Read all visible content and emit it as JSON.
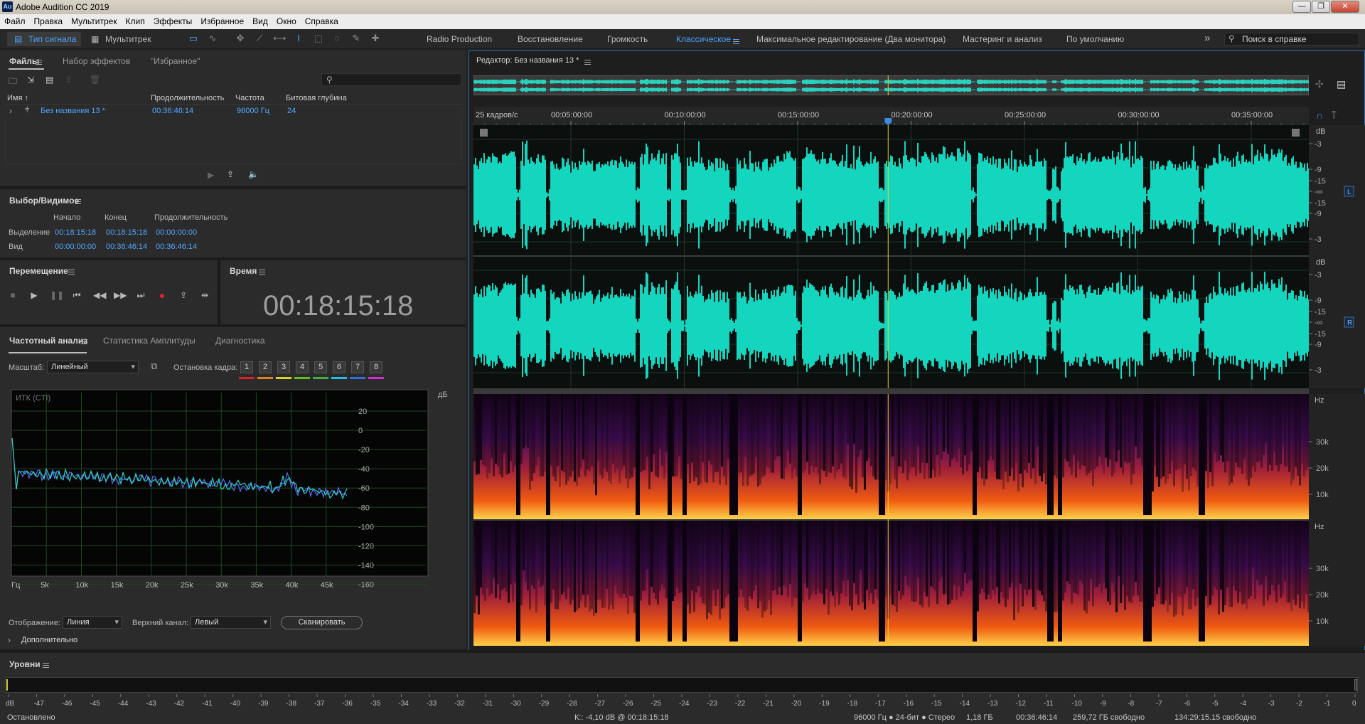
{
  "window": {
    "title": "Adobe Audition CC 2019",
    "app_badge": "Au",
    "controls": [
      "—",
      "❐",
      "✕"
    ]
  },
  "menu": [
    "Файл",
    "Правка",
    "Мультитрек",
    "Клип",
    "Эффекты",
    "Избранное",
    "Вид",
    "Окно",
    "Справка"
  ],
  "toolbar": {
    "waveform_label": "Тип сигнала",
    "multitrack_label": "Мультитрек",
    "workspaces": [
      "Radio Production",
      "Восстановление",
      "Громкость",
      "Классическое",
      "Максимальное редактирование (Два монитора)",
      "Мастеринг и анализ",
      "По умолчанию"
    ],
    "active_workspace": "Классическое",
    "more": "»",
    "help_placeholder": "Поиск в справке"
  },
  "files_panel": {
    "tabs": [
      "Файлы",
      "Набор эффектов",
      "\"Избранное\""
    ],
    "columns": [
      "Имя ↑",
      "Продолжительность",
      "Частота",
      "Битовая глубина"
    ],
    "rows": [
      {
        "name": "Без названия 13 *",
        "duration": "00:36:46:14",
        "rate": "96000 Гц",
        "depth": "24"
      }
    ]
  },
  "selection_panel": {
    "title": "Выбор/Видимое",
    "headers": [
      "Начало",
      "Конец",
      "Продолжительность"
    ],
    "selection_label": "Выделение",
    "selection": [
      "00:18:15:18",
      "00:18:15:18",
      "00:00:00:00"
    ],
    "view_label": "Вид",
    "view": [
      "00:00:00:00",
      "00:36:46:14",
      "00:36:46:14"
    ]
  },
  "transport": {
    "title": "Перемещение"
  },
  "time_panel": {
    "title": "Время",
    "value": "00:18:15:18"
  },
  "freq_panel": {
    "tabs": [
      "Частотный анализ",
      "Статистика Амплитуды",
      "Диагностика"
    ],
    "scale_label": "Масштаб:",
    "scale_value": "Линейный",
    "freeze_label": "Остановка кадра:",
    "freeze_buttons": [
      "1",
      "2",
      "3",
      "4",
      "5",
      "6",
      "7",
      "8"
    ],
    "freeze_colors": [
      "#e02020",
      "#e08020",
      "#e0d020",
      "#60c020",
      "#40b040",
      "#20c0e0",
      "#3070e0",
      "#d030d0"
    ],
    "graph_label": "ИТК (CTI)",
    "y_unit": "дБ",
    "y_ticks": [
      "20",
      "0",
      "-20",
      "-40",
      "-60",
      "-80",
      "-100",
      "-120",
      "-140",
      "-160"
    ],
    "x_ticks": [
      "Гц",
      "5k",
      "10k",
      "15k",
      "20k",
      "25k",
      "30k",
      "35k",
      "40k",
      "45k"
    ],
    "display_label": "Отображение:",
    "display_value": "Линия",
    "channel_label": "Верхний канал:",
    "channel_value": "Левый",
    "scan_label": "Сканировать",
    "advanced_label": "Дополнительно"
  },
  "editor": {
    "title": "Редактор: Без названия 13 *",
    "fps_label": "25 кадров/с",
    "time_ticks": [
      "00:05:00:00",
      "00:10:00:00",
      "00:15:00:00",
      "00:20:00:00",
      "00:25:00:00",
      "00:30:00:00",
      "00:35:00:00"
    ],
    "db_unit": "dB",
    "db_ticks": [
      "-3",
      "-9",
      "-15",
      "-∞",
      "-15",
      "-9",
      "-3"
    ],
    "channel_left": "L",
    "channel_right": "R",
    "hz_unit": "Hz",
    "hz_ticks": [
      "30k",
      "20k",
      "10k"
    ],
    "playhead_fraction": 0.4964
  },
  "levels": {
    "title": "Уровни",
    "scale": [
      "dB",
      "-47",
      "-46",
      "-45",
      "-44",
      "-43",
      "-42",
      "-41",
      "-40",
      "-39",
      "-38",
      "-37",
      "-36",
      "-35",
      "-34",
      "-33",
      "-32",
      "-31",
      "-30",
      "-29",
      "-28",
      "-27",
      "-26",
      "-25",
      "-24",
      "-23",
      "-22",
      "-21",
      "-20",
      "-19",
      "-18",
      "-17",
      "-16",
      "-15",
      "-14",
      "-13",
      "-12",
      "-11",
      "-10",
      "-9",
      "-8",
      "-7",
      "-6",
      "-5",
      "-4",
      "-3",
      "-2",
      "-1",
      "0"
    ]
  },
  "status": {
    "left": "Остановлено",
    "cursor": "К:: -4,10 dB @ 00:18:15:18",
    "format": "96000 Гц ● 24-бит ● Стерео",
    "size": "1,18 ГБ",
    "duration": "00:36:46:14",
    "free": "259,72 ГБ свободно",
    "free_time": "134:29:15.15 свободно"
  }
}
